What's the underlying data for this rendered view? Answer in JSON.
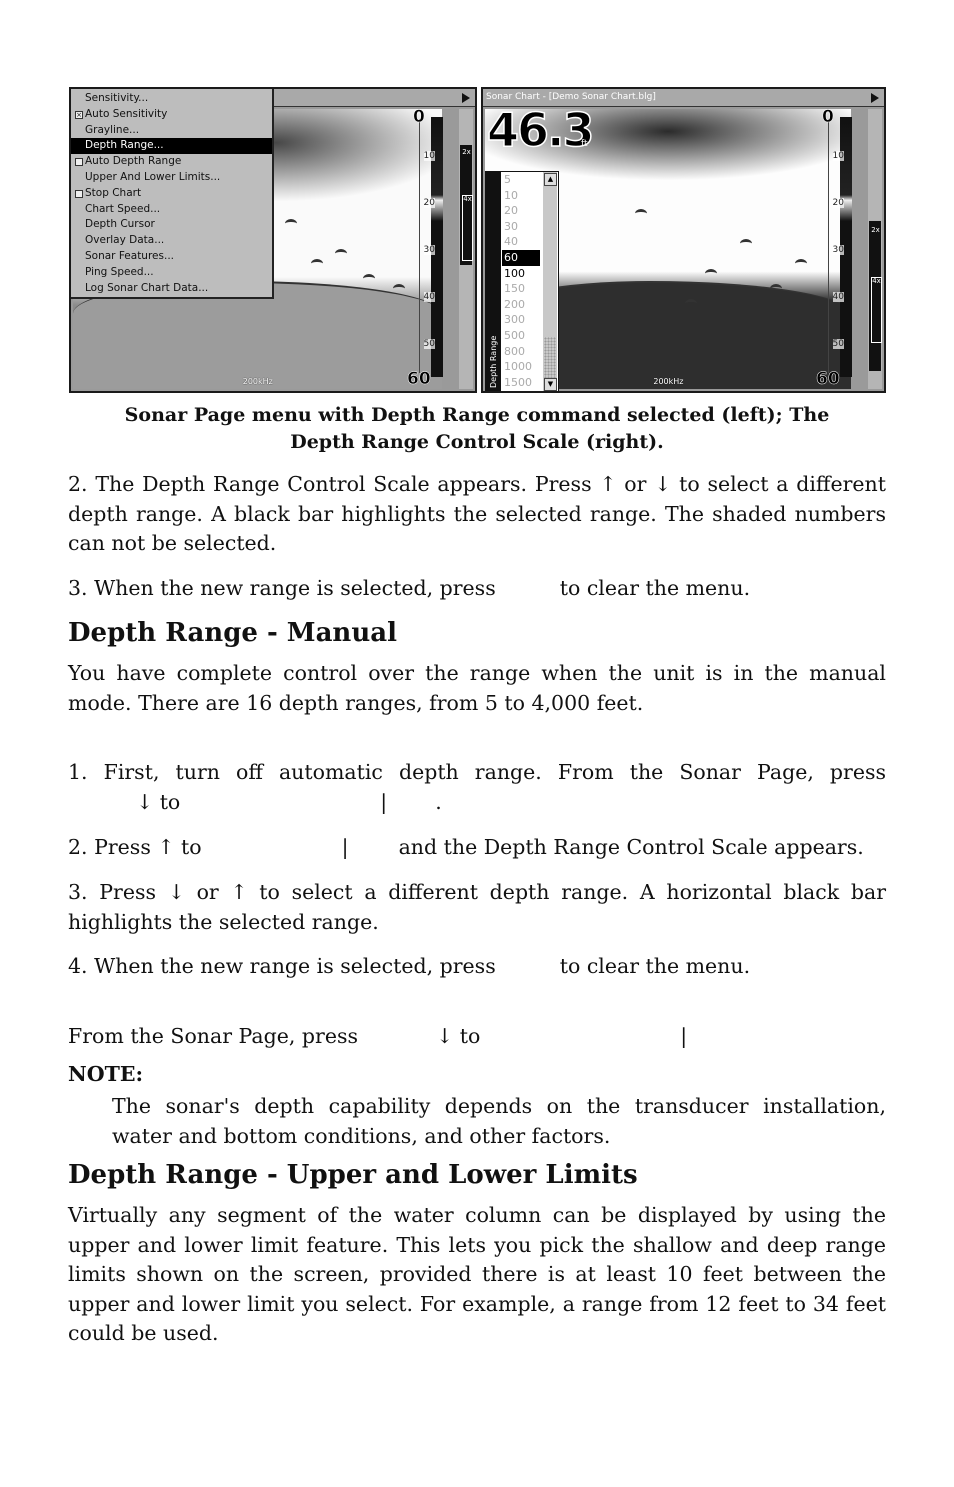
{
  "figures": {
    "left": {
      "menu": {
        "items": [
          {
            "label": "Sensitivity...",
            "checkbox": null,
            "selected": false
          },
          {
            "label": "Auto Sensitivity",
            "checkbox": "checked",
            "selected": false
          },
          {
            "label": "Grayline...",
            "checkbox": null,
            "selected": false
          },
          {
            "label": "Depth Range...",
            "checkbox": null,
            "selected": true
          },
          {
            "label": "Auto Depth Range",
            "checkbox": "unchecked",
            "selected": false
          },
          {
            "label": "Upper And Lower Limits...",
            "checkbox": null,
            "selected": false
          },
          {
            "label": "Stop Chart",
            "checkbox": "unchecked",
            "selected": false
          },
          {
            "label": "Chart Speed...",
            "checkbox": null,
            "selected": false
          },
          {
            "label": "Depth Cursor",
            "checkbox": null,
            "selected": false
          },
          {
            "label": "Overlay Data...",
            "checkbox": null,
            "selected": false
          },
          {
            "label": "Sonar Features...",
            "checkbox": null,
            "selected": false
          },
          {
            "label": "Ping Speed...",
            "checkbox": null,
            "selected": false
          },
          {
            "label": "Log Sonar Chart Data...",
            "checkbox": null,
            "selected": false
          }
        ]
      },
      "scale": {
        "top": "0",
        "bottom": "60",
        "ticks": [
          "10",
          "20",
          "30",
          "40",
          "50"
        ]
      },
      "frequency": "200kHz",
      "zoom_labels": [
        "2x",
        "4x"
      ]
    },
    "right": {
      "window_title": "Sonar Chart - [Demo Sonar Chart.blg]",
      "depth_readout": "46.3",
      "depth_unit": "ft",
      "depth_range_control": {
        "label": "Depth Range",
        "options": [
          "5",
          "10",
          "20",
          "30",
          "40",
          "60",
          "100",
          "150",
          "200",
          "300",
          "500",
          "800",
          "1000",
          "1500"
        ],
        "selected": "60",
        "selectable": [
          "60",
          "100"
        ]
      },
      "scale": {
        "top": "0",
        "bottom": "60",
        "ticks": [
          "10",
          "20",
          "30",
          "40",
          "50"
        ]
      },
      "frequency": "200kHz",
      "zoom_labels": [
        "2x",
        "4x"
      ]
    },
    "caption_line1": "Sonar Page menu with Depth Range command selected (left); The",
    "caption_line2": "Depth Range Control Scale (right)."
  },
  "steps_a": {
    "step2": "2. The Depth Range Control Scale appears. Press ↑ or ↓ to select a different depth range. A black bar highlights the selected range. The shaded numbers can not be selected.",
    "step3_before": "3. When the new range is selected, press",
    "step3_after": "to clear the menu."
  },
  "section_manual": {
    "heading": "Depth Range - Manual",
    "intro": "You have complete control over the range when the unit is in the manual mode. There are 16 depth ranges, from 5 to 4,000 feet.",
    "step1_line1": "1. First, turn off automatic depth range. From the Sonar Page, press",
    "step1_line2_a": "↓ to",
    "step1_line2_b": "|",
    "step1_line2_c": ".",
    "step2_a": "2. Press ↑ to",
    "step2_b": "|",
    "step2_c": "and the Depth Range Control Scale appears.",
    "step3": "3. Press ↓ or ↑ to select a different depth range. A horizontal black bar highlights the selected range.",
    "step4_before": "4. When the new range is selected, press",
    "step4_after": "to clear the menu.",
    "auto_a": "From the Sonar Page, press",
    "auto_b": "↓ to",
    "auto_c": "|"
  },
  "note": {
    "label": "NOTE:",
    "body": "The sonar's depth capability depends on the transducer installation, water and bottom conditions, and other factors."
  },
  "section_limits": {
    "heading": "Depth Range - Upper and Lower Limits",
    "body": "Virtually any segment of the water column can be displayed by using the upper and lower limit feature. This lets you pick the shallow and deep range limits shown on the screen, provided there is at least 10 feet between the upper and lower limit you select. For example, a range from 12 feet to 34 feet could be used."
  }
}
